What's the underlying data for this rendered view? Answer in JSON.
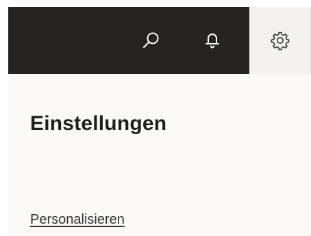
{
  "topbar": {
    "background": "#252423",
    "icons": {
      "search": "search-icon",
      "notifications": "bell-icon",
      "settings": "gear-icon"
    },
    "active_item": "settings"
  },
  "settings_panel": {
    "title": "Einstellungen",
    "links": {
      "personalize": "Personalisieren"
    }
  }
}
